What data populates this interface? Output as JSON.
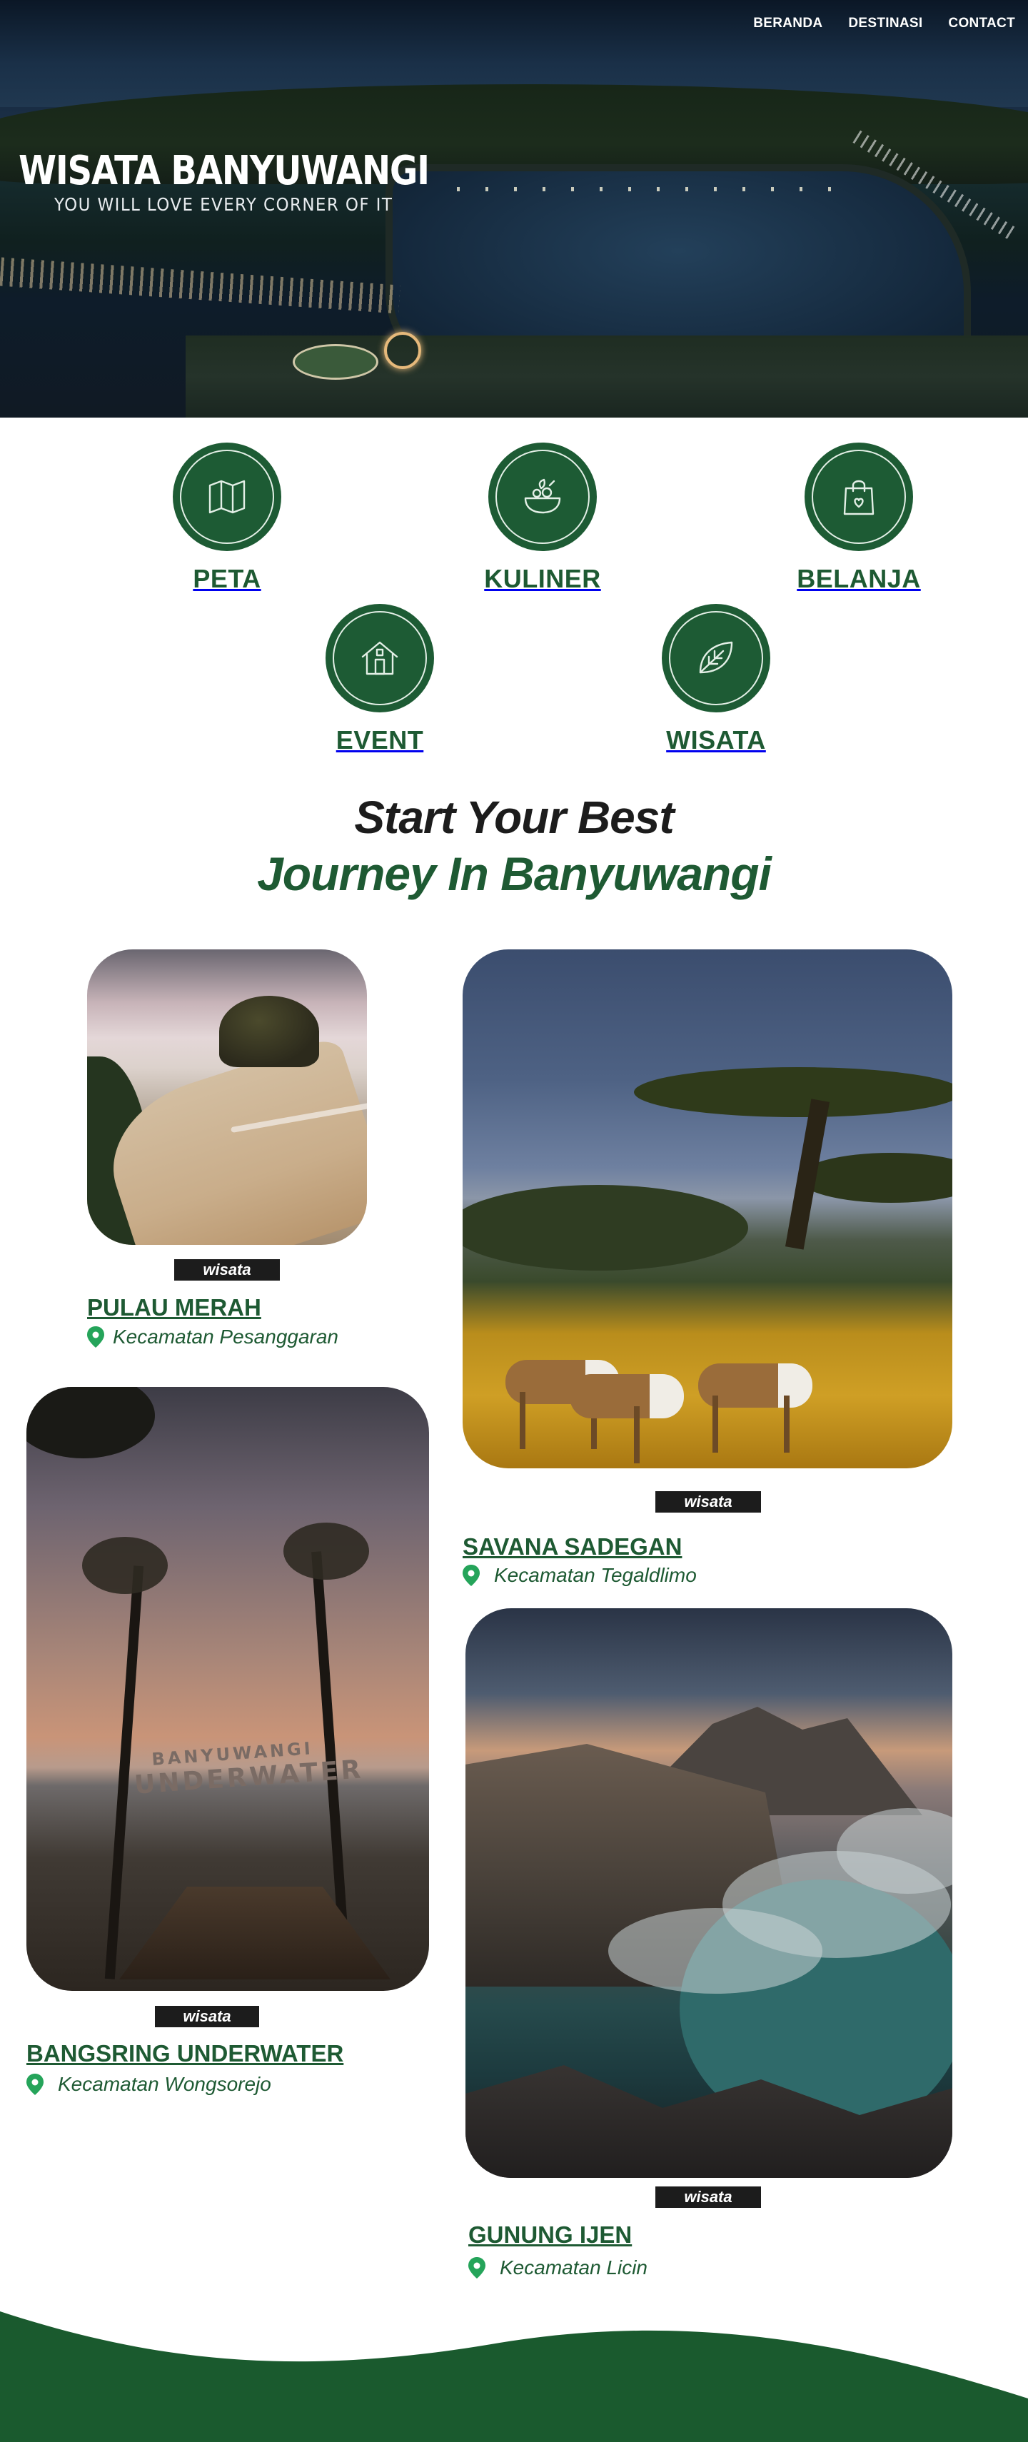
{
  "nav": {
    "items": [
      "BERANDA",
      "DESTINASI",
      "CONTACT"
    ]
  },
  "hero": {
    "title": "WISATA BANYUWANGI",
    "subtitle": "YOU WILL LOVE EVERY CORNER OF IT"
  },
  "categories": [
    {
      "label": "PETA",
      "icon": "map-icon"
    },
    {
      "label": "KULINER",
      "icon": "food-bowl-icon"
    },
    {
      "label": "BELANJA",
      "icon": "shopping-bag-icon"
    },
    {
      "label": "EVENT",
      "icon": "house-icon"
    },
    {
      "label": "WISATA",
      "icon": "leaf-icon"
    }
  ],
  "heading": {
    "line1": "Start Your Best",
    "line2": "Journey In Banyuwangi"
  },
  "destinations": [
    {
      "badge": "wisata",
      "name": "PULAU MERAH",
      "location": "Kecamatan Pesanggaran",
      "icon": "location-pin-icon"
    },
    {
      "badge": "wisata",
      "name": "SAVANA SADEGAN",
      "location": "Kecamatan Tegaldlimo",
      "icon": "location-pin-icon"
    },
    {
      "badge": "wisata",
      "name": "BANGSRING UNDERWATER",
      "location": "Kecamatan Wongsorejo",
      "icon": "location-pin-icon"
    },
    {
      "badge": "wisata",
      "name": "GUNUNG IJEN",
      "location": "Kecamatan Licin",
      "icon": "location-pin-icon"
    }
  ],
  "photo_text": {
    "bangsring_sign_line1": "BANYUWANGI",
    "bangsring_sign_line2": "UNDERWATER"
  },
  "colors": {
    "brand_green": "#1e5a33",
    "badge_bg": "#1c1c1c",
    "pin_green": "#25a45a",
    "footer_green": "#1a5a2e"
  }
}
